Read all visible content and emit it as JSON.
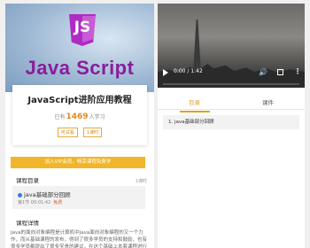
{
  "course": {
    "banner_text": "Java Script",
    "badge_text": "JS",
    "title": "JavaScript进阶应用教程",
    "learners_prefix": "已有",
    "learners_count": "1469",
    "learners_suffix": "人学习",
    "tags": [
      "可试看",
      "1课时"
    ]
  },
  "actions": {
    "vip_label": "加入VIP会员，畅享课程免费学"
  },
  "catalog": {
    "heading": "课程目录",
    "count": "1课时",
    "lessons": [
      {
        "title": "java基础部分回顾",
        "meta": "第1节  00:01:42",
        "badge": "免费"
      }
    ]
  },
  "details": {
    "heading": "课程详情",
    "text": "Java的面向对象编程是计算机中Java面向对象编程的又一个力作，而从基础课程的发布，得到了很多学员的支持和鼓励，也有很多学员都提出了很多宝贵的建议，在这个基础上本套课程进行了全面的升级……"
  },
  "player": {
    "time": "0:00 / 1:42",
    "progress": 0.0,
    "volume_icon": "volume-icon",
    "fullscreen_icon": "fullscreen-icon",
    "more_icon": "more-options-icon"
  },
  "tabs": {
    "items": [
      "目录",
      "课件"
    ],
    "active": 0
  },
  "toc": {
    "items": [
      "1. java基础部分回顾"
    ]
  },
  "colors": {
    "accent": "#e0a21f",
    "vip": "#f0b52a",
    "brand": "#8a1d9c"
  }
}
